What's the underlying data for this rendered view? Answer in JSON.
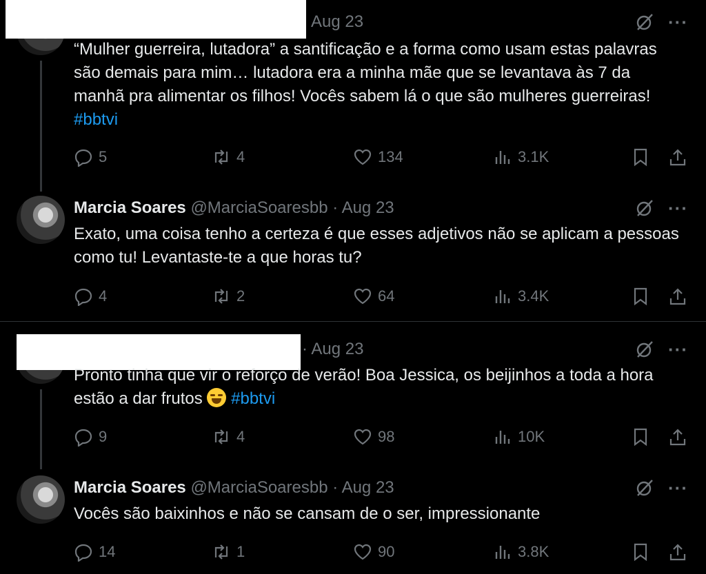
{
  "tweets": [
    {
      "name": "",
      "handle": "",
      "date": "Aug 23",
      "text": "“Mulher guerreira, lutadora” a santificação e a forma como usam estas palavras são demais para mim… lutadora era a minha mãe que se levantava às 7 da manhã pra alimentar os filhos! Vocês sabem lá o que são mulheres guerreiras! ",
      "hashtag": "#bbtvi",
      "replies": "5",
      "retweets": "4",
      "likes": "134",
      "views": "3.1K"
    },
    {
      "name": "Marcia Soares",
      "handle": "@MarciaSoaresbb",
      "dot": "·",
      "date": "Aug 23",
      "text": "Exato, uma coisa tenho a certeza é que esses adjetivos não se aplicam a pessoas como tu! Levantaste-te a que horas tu?",
      "replies": "4",
      "retweets": "2",
      "likes": "64",
      "views": "3.4K"
    },
    {
      "name": "",
      "handle": "",
      "dot": "·",
      "date": "Aug 23",
      "text": "Pronto tinha que vir o reforço de verão! Boa Jessica, os beijinhos a toda a hora estão a dar frutos ",
      "hashtag": "#bbtvi",
      "replies": "9",
      "retweets": "4",
      "likes": "98",
      "views": "10K"
    },
    {
      "name": "Marcia Soares",
      "handle": "@MarciaSoaresbb",
      "dot": "·",
      "date": "Aug 23",
      "text": "Vocês são baixinhos e não se cansam de o ser, impressionante",
      "replies": "14",
      "retweets": "1",
      "likes": "90",
      "views": "3.8K"
    }
  ],
  "icons": {
    "reply": "reply-icon",
    "retweet": "retweet-icon",
    "like": "heart-icon",
    "views": "views-icon",
    "bookmark": "bookmark-icon",
    "share": "share-icon",
    "grok": "grok-icon",
    "more": "more-icon"
  },
  "colors": {
    "background": "#000000",
    "text": "#e7e9ea",
    "muted": "#71767b",
    "accent": "#1d9bf0"
  }
}
